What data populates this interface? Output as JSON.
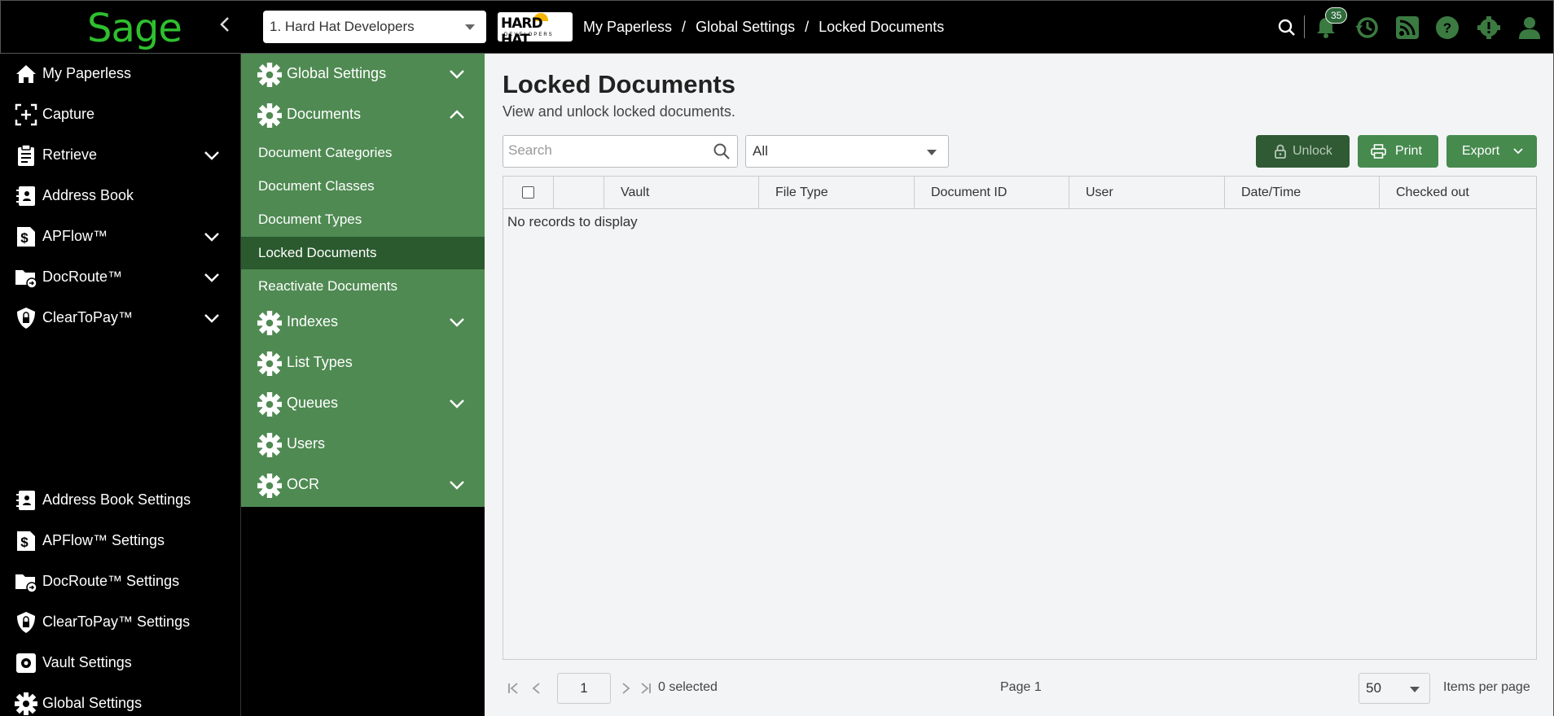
{
  "topbar": {
    "logo": "Sage",
    "tenant": "1. Hard Hat Developers",
    "brand_logo": {
      "name": "HARD HAT",
      "subtitle": "DEVELOPERS"
    },
    "breadcrumb": [
      "My Paperless",
      "Global Settings",
      "Locked Documents"
    ],
    "notification_count": "35",
    "icons": [
      "search-icon",
      "bell-icon",
      "history-icon",
      "rss-icon",
      "help-icon",
      "alert-gear-icon",
      "user-icon"
    ]
  },
  "leftnav": {
    "top_items": [
      {
        "label": "My Paperless",
        "icon": "home-icon",
        "expandable": false
      },
      {
        "label": "Capture",
        "icon": "capture-icon",
        "expandable": false
      },
      {
        "label": "Retrieve",
        "icon": "clipboard-icon",
        "expandable": true
      },
      {
        "label": "Address Book",
        "icon": "address-book-icon",
        "expandable": false
      },
      {
        "label": "APFlow™",
        "icon": "dollar-doc-icon",
        "expandable": true
      },
      {
        "label": "DocRoute™",
        "icon": "folder-route-icon",
        "expandable": true
      },
      {
        "label": "ClearToPay™",
        "icon": "shield-lock-icon",
        "expandable": true
      }
    ],
    "bottom_items": [
      {
        "label": "Address Book Settings",
        "icon": "address-book-icon"
      },
      {
        "label": "APFlow™ Settings",
        "icon": "dollar-doc-icon"
      },
      {
        "label": "DocRoute™ Settings",
        "icon": "folder-route-icon"
      },
      {
        "label": "ClearToPay™ Settings",
        "icon": "shield-lock-icon"
      },
      {
        "label": "Vault Settings",
        "icon": "vault-gear-icon"
      },
      {
        "label": "Global Settings",
        "icon": "gear-icon"
      }
    ]
  },
  "settings": {
    "global": "Global Settings",
    "documents": "Documents",
    "document_sub": [
      "Document Categories",
      "Document Classes",
      "Document Types",
      "Locked Documents",
      "Reactivate Documents"
    ],
    "active_sub": "Locked Documents",
    "others": [
      {
        "label": "Indexes",
        "expandable": true
      },
      {
        "label": "List Types",
        "expandable": false
      },
      {
        "label": "Queues",
        "expandable": true
      },
      {
        "label": "Users",
        "expandable": false
      },
      {
        "label": "OCR",
        "expandable": true
      }
    ]
  },
  "main": {
    "title": "Locked Documents",
    "subtitle": "View and unlock locked documents.",
    "search_placeholder": "Search",
    "filter_value": "All",
    "buttons": {
      "unlock": "Unlock",
      "print": "Print",
      "export": "Export"
    },
    "columns": [
      "Vault",
      "File Type",
      "Document ID",
      "User",
      "Date/Time",
      "Checked out"
    ],
    "empty_message": "No records to display",
    "pager": {
      "page_input": "1",
      "selected": "0 selected",
      "page_label": "Page 1",
      "page_size": "50",
      "items_per_page": "Items per page"
    }
  },
  "colors": {
    "accent": "#4f8a52",
    "accent_dark": "#2a5a2e",
    "logo_green": "#2ec02e",
    "topbar": "#000000"
  }
}
